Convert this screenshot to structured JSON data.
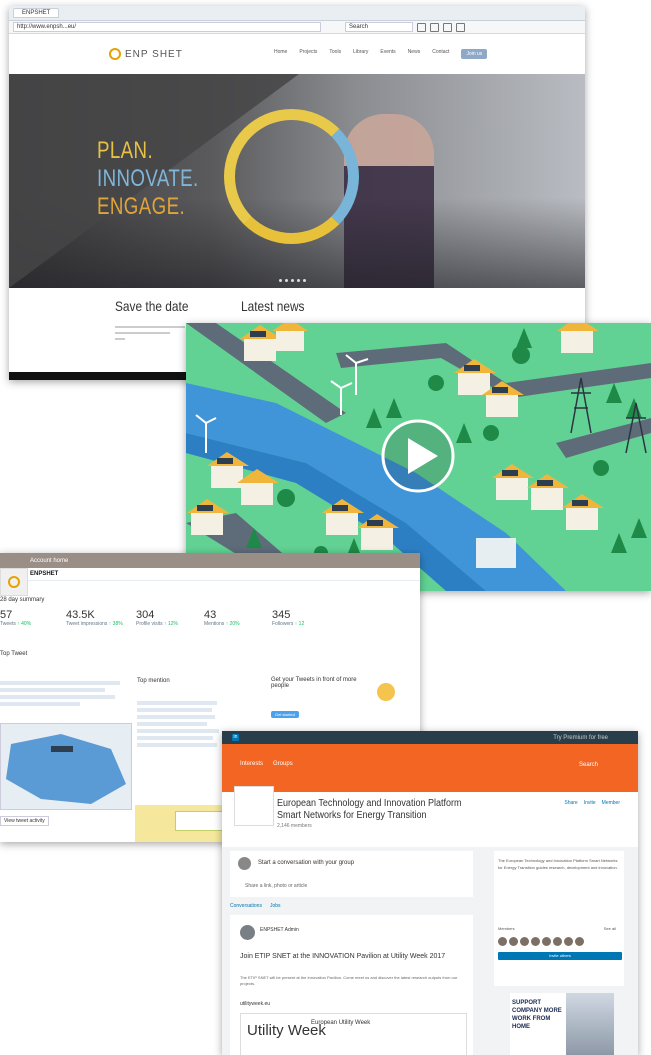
{
  "website": {
    "tab_title": "ENPSHET",
    "url": "http://www.enpsh...eu/",
    "search_placeholder": "Search",
    "logo_text": "ENP SHET",
    "nav": [
      "Home",
      "Projects",
      "Tools",
      "Library",
      "Events",
      "News",
      "Contact"
    ],
    "nav_cta": "Join us",
    "slogan": [
      "PLAN.",
      "INNOVATE.",
      "ENGAGE."
    ],
    "save_the_date": "Save the date",
    "latest_news": "Latest news",
    "colors": {
      "yellow": "#e7c243",
      "blue": "#7fb6da",
      "orange": "#e0a43a"
    }
  },
  "video": {
    "play_icon": "play-icon"
  },
  "twitter": {
    "top_text": "Account home",
    "handle": "ENPSHET",
    "stats_heading": "28 day summary",
    "stats": [
      {
        "label": "Tweets",
        "num": "57",
        "chg": "↑ 40%"
      },
      {
        "label": "Tweet impressions",
        "num": "43.5K",
        "chg": "↑ 38%"
      },
      {
        "label": "Profile visits",
        "num": "304",
        "chg": "↑ 12%"
      },
      {
        "label": "Mentions",
        "num": "43",
        "chg": "↑ 20%"
      },
      {
        "label": "Followers",
        "num": "345",
        "chg": "↑ 12"
      }
    ],
    "highlights": "Top Tweet",
    "top_mention": "Top mention",
    "card_title": "Get your Tweets in front of more people",
    "card_button": "Get started",
    "edit_button": "View tweet activity"
  },
  "linkedin": {
    "nav_tabs": [
      "Interests",
      "Groups"
    ],
    "top_right": "Try Premium for free",
    "search": "Search",
    "group_title_line1": "European Technology and Innovation Platform",
    "group_title_line2": "Smart Networks for Energy Transition",
    "members": "2,146 members",
    "actions": [
      "Share",
      "Invite",
      "Member"
    ],
    "share_prompt": "Start a conversation with your group",
    "share_sub": "Share a link, photo or article",
    "feed_tabs": [
      "Conversations",
      "Jobs"
    ],
    "post_author": "ENPSHET Admin",
    "post_headline": "Join ETIP SNET at the INNOVATION Pavilion at Utility Week 2017",
    "post_body": "The ETIP SNET will be present at the Innovation Pavilion. Come meet us and discover the latest research outputs from our projects.",
    "post_link": "utilityweek.eu",
    "uw_logo": "Utility Week",
    "uw_title": "European Utility Week",
    "side_text": "The European Technology and Innovation Platform Smart Networks for Energy Transition guides research, development and innovation.",
    "side_members": "Members",
    "side_see_all": "See all",
    "side_button": "Invite others",
    "ad_text": "SUPPORT COMPANY MORE WORK FROM HOME"
  }
}
